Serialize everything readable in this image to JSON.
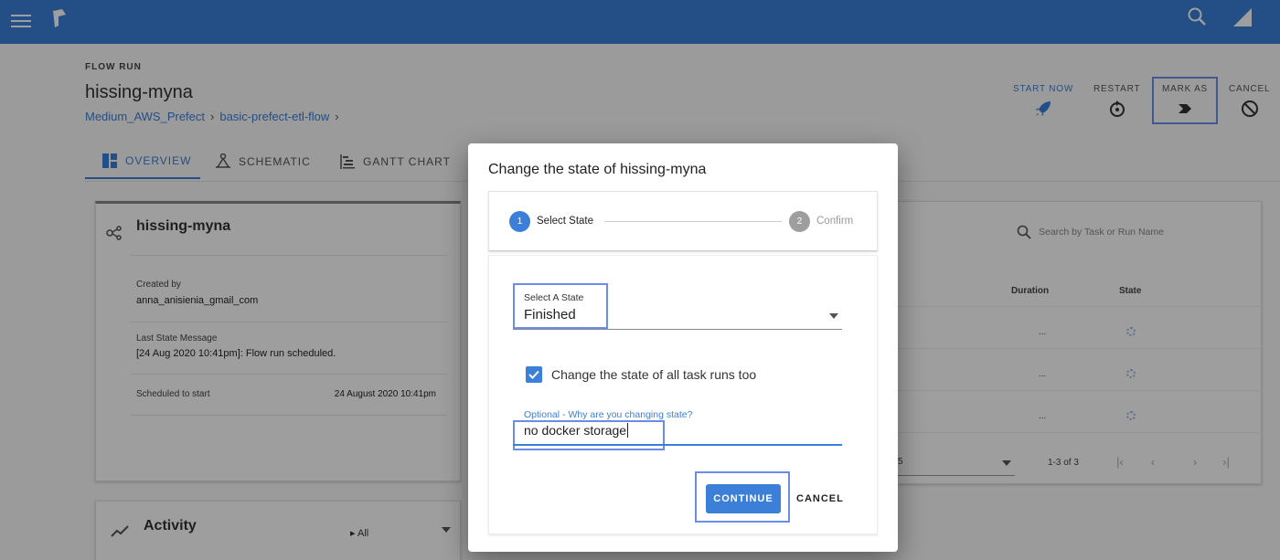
{
  "header": {
    "menu_icon": "menu-icon",
    "logo_icon": "prefect-logo",
    "search_icon": "search-icon",
    "signal_icon": "signal-icon"
  },
  "page": {
    "section_label": "FLOW RUN",
    "title": "hissing-myna",
    "breadcrumb": [
      "Medium_AWS_Prefect",
      "basic-prefect-etl-flow"
    ],
    "breadcrumb_sep": "›"
  },
  "actions": {
    "start_now": "START NOW",
    "restart": "RESTART",
    "mark_as": "MARK AS",
    "cancel": "CANCEL"
  },
  "tabs": {
    "overview": "OVERVIEW",
    "schematic": "SCHEMATIC",
    "gantt": "GANTT CHART"
  },
  "details": {
    "title": "hissing-myna",
    "created_by_label": "Created by",
    "created_by": "anna_anisienia_gmail_com",
    "last_state_label": "Last State Message",
    "last_state": "[24 Aug 2020 10:41pm]: Flow run scheduled.",
    "scheduled_label": "Scheduled to start",
    "scheduled": "24 August 2020 10:41pm"
  },
  "activity": {
    "title": "Activity",
    "filter": "All"
  },
  "task_runs": {
    "search_placeholder": "Search by Task or Run Name",
    "columns": {
      "duration": "Duration",
      "state": "State"
    },
    "rows": [
      "...",
      "...",
      "..."
    ],
    "page_size": "5",
    "range": "1-3 of 3"
  },
  "dialog": {
    "title": "Change the state of hissing-myna",
    "steps": [
      {
        "num": "1",
        "label": "Select State"
      },
      {
        "num": "2",
        "label": "Confirm"
      }
    ],
    "select_label": "Select A State",
    "select_value": "Finished",
    "checkbox_label": "Change the state of all task runs too",
    "checkbox_checked": true,
    "reason_label": "Optional - Why are you changing state?",
    "reason_value": "no docker storage",
    "continue": "CONTINUE",
    "cancel": "CANCEL"
  },
  "colors": {
    "primary": "#3b7fd9",
    "highlight": "#6a8ee8"
  }
}
